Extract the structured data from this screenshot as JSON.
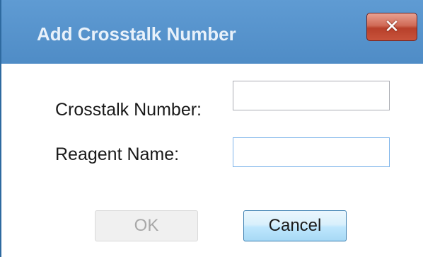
{
  "window": {
    "title": "Add Crosstalk Number",
    "close_icon": "close-icon",
    "close_glyph": "✕"
  },
  "form": {
    "crosstalk_number": {
      "label": "Crosstalk Number:",
      "value": ""
    },
    "reagent_name": {
      "label": "Reagent Name:",
      "value": ""
    }
  },
  "buttons": {
    "ok_label": "OK",
    "ok_enabled": false,
    "cancel_label": "Cancel"
  },
  "colors": {
    "titlebar": "#5f9bd3",
    "title_text": "#e8f1fa",
    "close_button": "#c8533b",
    "cancel_button_border": "#3c7fb1",
    "focused_input_border": "#7eb4ea"
  }
}
